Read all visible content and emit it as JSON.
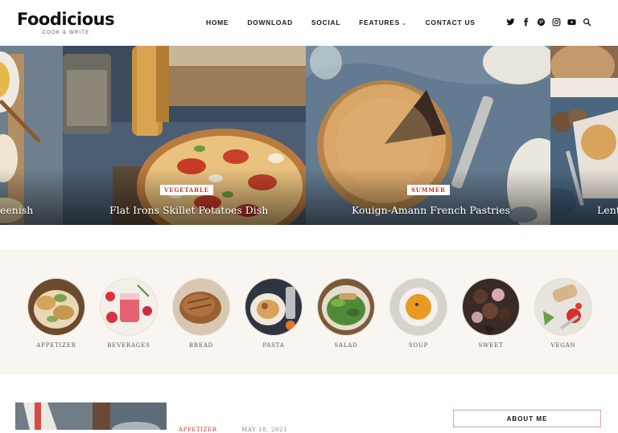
{
  "site": {
    "title": "Foodicious",
    "tagline": "COOK & WRITE"
  },
  "nav": {
    "items": [
      {
        "label": "HOME"
      },
      {
        "label": "DOWNLOAD"
      },
      {
        "label": "SOCIAL"
      },
      {
        "label": "FEATURES",
        "has_dropdown": true
      },
      {
        "label": "CONTACT US"
      }
    ]
  },
  "social_icons": [
    "twitter-icon",
    "facebook-icon",
    "pinterest-icon",
    "instagram-icon",
    "youtube-icon",
    "search-icon"
  ],
  "slider": {
    "slides": [
      {
        "title": "eenish"
      },
      {
        "badge": "VEGETABLE",
        "title": "Flat Irons Skillet Potatoes Dish"
      },
      {
        "badge": "SUMMER",
        "title": "Kouign-Amann French Pastries"
      },
      {
        "title": "Lent"
      }
    ]
  },
  "categories": [
    {
      "label": "APPETIZER"
    },
    {
      "label": "BEVERAGES"
    },
    {
      "label": "BREAD"
    },
    {
      "label": "PASTA"
    },
    {
      "label": "SALAD"
    },
    {
      "label": "SOUP"
    },
    {
      "label": "SWEET"
    },
    {
      "label": "VEGAN"
    }
  ],
  "latest_post": {
    "category": "APPETIZER",
    "date": "MAY 18, 2021"
  },
  "sidebar": {
    "about_title": "ABOUT ME"
  },
  "colors": {
    "accent": "#c0392b",
    "category_band": "#f9f6f1"
  }
}
